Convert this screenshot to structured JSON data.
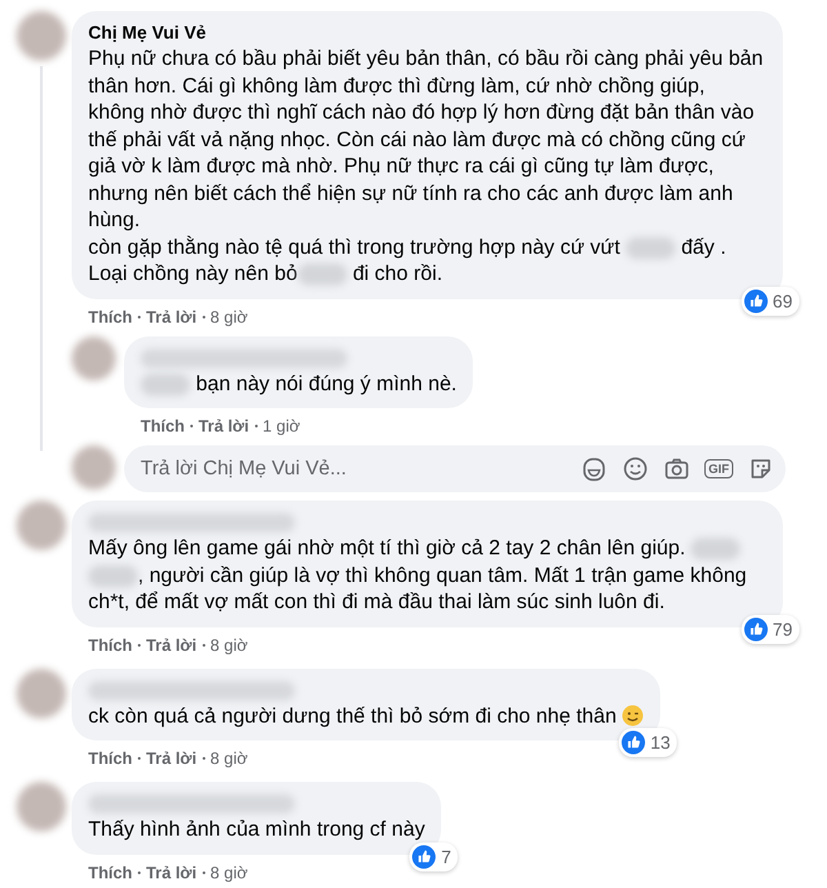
{
  "comments": [
    {
      "author": "Chị Mẹ Vui Vẻ",
      "author_blurred": false,
      "parts": [
        {
          "kind": "text",
          "text": "Phụ nữ chưa có bầu phải biết yêu bản thân, có bầu rồi càng phải yêu bản thân hơn. Cái gì không làm được thì đừng làm, cứ nhờ chồng giúp, không nhờ được thì nghĩ cách nào đó hợp lý hơn đừng đặt bản thân vào thế phải vất vả nặng nhọc. Còn cái nào làm được mà có chồng cũng cứ giả vờ k làm được mà nhờ. Phụ nữ thực ra cái gì cũng tự làm được, nhưng nên biết cách thể hiện sự nữ tính ra cho các anh được làm anh hùng.\ncòn gặp thằng nào tệ quá thì trong trường hợp này cứ vứt "
        },
        {
          "kind": "blur"
        },
        {
          "kind": "text",
          "text": " đấy .\nLoại chồng này nên bỏ"
        },
        {
          "kind": "blur"
        },
        {
          "kind": "text",
          "text": " đi cho rồi."
        }
      ],
      "emoji": false,
      "likes": "69",
      "like": "Thích",
      "reply": "Trả lời",
      "time": "8 giờ",
      "replies": [
        {
          "author_blurred": true,
          "parts": [
            {
              "kind": "blur"
            },
            {
              "kind": "text",
              "text": " bạn này nói đúng ý mình nè."
            }
          ],
          "emoji": false,
          "like": "Thích",
          "reply": "Trả lời",
          "time": "1 giờ"
        }
      ],
      "reply_box": {
        "placeholder": "Trả lời Chị Mẹ Vui Vẻ...",
        "gif_label": "GIF"
      }
    },
    {
      "author_blurred": true,
      "parts": [
        {
          "kind": "text",
          "text": "Mấy ông lên game gái nhờ một tí thì giờ cả 2 tay 2 chân lên giúp. "
        },
        {
          "kind": "blur"
        },
        {
          "kind": "break"
        },
        {
          "kind": "blur"
        },
        {
          "kind": "text",
          "text": ", người cần giúp là vợ thì không quan tâm. Mất 1 trận game không ch*t, để mất vợ mất con thì đi mà đầu thai làm súc sinh luôn đi."
        }
      ],
      "emoji": false,
      "likes": "79",
      "like": "Thích",
      "reply": "Trả lời",
      "time": "8 giờ"
    },
    {
      "author_blurred": true,
      "parts": [
        {
          "kind": "text",
          "text": "ck còn quá cả người dưng thế thì bỏ sớm đi cho nhẹ thân"
        }
      ],
      "emoji": true,
      "likes": "13",
      "like": "Thích",
      "reply": "Trả lời",
      "time": "8 giờ"
    },
    {
      "author_blurred": true,
      "parts": [
        {
          "kind": "text",
          "text": "Thấy hình ảnh của mình trong cf này"
        }
      ],
      "emoji": false,
      "likes": "7",
      "like": "Thích",
      "reply": "Trả lời",
      "time": "8 giờ"
    }
  ]
}
